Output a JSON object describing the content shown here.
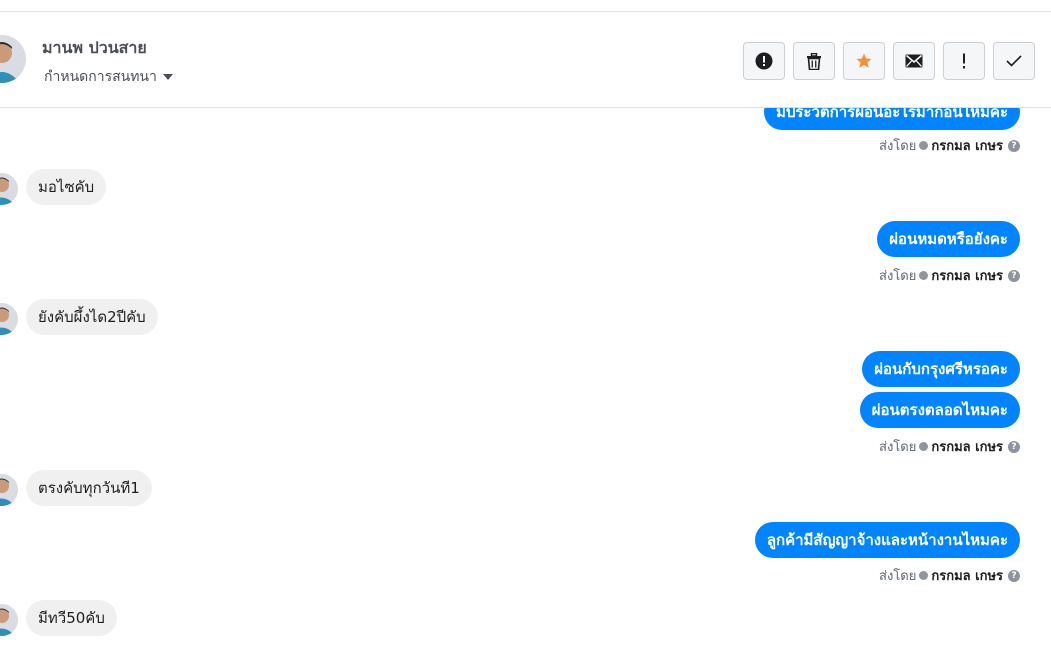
{
  "header": {
    "contact_name": "มานพ ปวนสาย",
    "conversation_settings": "กำหนดการสนทนา"
  },
  "actions": [
    {
      "name": "report",
      "label": "!",
      "icon": "alert-circle-icon"
    },
    {
      "name": "delete",
      "icon": "trash-icon"
    },
    {
      "name": "star",
      "icon": "star-icon",
      "color": "#f7923b"
    },
    {
      "name": "mark-unread",
      "icon": "envelope-icon"
    },
    {
      "name": "spam",
      "label": "!",
      "icon": "exclamation-icon"
    },
    {
      "name": "done",
      "icon": "check-icon"
    }
  ],
  "meta": {
    "sent_by_label": "ส่งโดย",
    "sender_name": "กรกมล เกษร",
    "help": "?"
  },
  "messages": [
    {
      "dir": "out",
      "text": "มีประวัติการผ่อนอะไรมาก่อนไหมคะ"
    },
    {
      "dir": "in",
      "text": "มอไซคับ"
    },
    {
      "dir": "out",
      "text": "ผ่อนหมดหรือยังคะ"
    },
    {
      "dir": "in",
      "text": "ยังคับผึ้งได2ปีคับ"
    },
    {
      "dir": "out",
      "text": "ผ่อนกับกรุงศรีหรอคะ"
    },
    {
      "dir": "out",
      "text": "ผ่อนตรงตลอดไหมคะ"
    },
    {
      "dir": "in",
      "text": "ตรงคับทุกวันที1"
    },
    {
      "dir": "out",
      "text": "ลูกค้ามีสัญญาจ้างและหน้างานไหมคะ"
    },
    {
      "dir": "in",
      "text": "มีทวี50คับ"
    }
  ],
  "colors": {
    "outgoing_bubble": "#0084ff",
    "incoming_bubble": "#f1f0f0",
    "star": "#f7923b"
  }
}
